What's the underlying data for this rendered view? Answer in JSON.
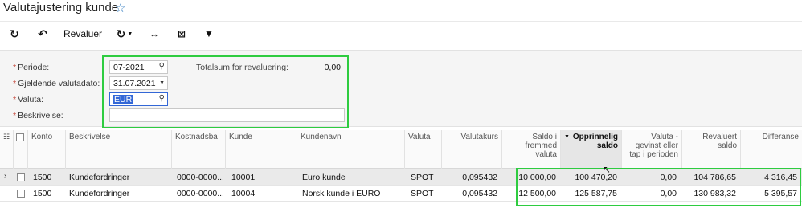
{
  "page": {
    "title": "Valutajustering kunde"
  },
  "toolbar": {
    "revaluer_label": "Revaluer"
  },
  "form": {
    "periode_label": "Periode:",
    "periode_value": "07-2021",
    "dato_label": "Gjeldende valutadato:",
    "dato_value": "31.07.2021",
    "valuta_label": "Valuta:",
    "valuta_value": "EUR",
    "beskrivelse_label": "Beskrivelse:",
    "beskrivelse_value": "",
    "total_label": "Totalsum for revaluering:",
    "total_value": "0,00"
  },
  "grid": {
    "columns": {
      "konto": "Konto",
      "beskrivelse": "Beskrivelse",
      "kostnadssted": "Kostnadsba",
      "kunde": "Kunde",
      "kundenavn": "Kundenavn",
      "valuta": "Valuta",
      "valutakurs": "Valutakurs",
      "saldo_fremmed": "Saldo i fremmed valuta",
      "opprinnelig_saldo": "Opprinnelig saldo",
      "gevinst_tap": "Valuta - gevinst eller tap i perioden",
      "revaluert_saldo": "Revaluert saldo",
      "differanse": "Differanse"
    },
    "rows": [
      {
        "konto": "1500",
        "beskrivelse": "Kundefordringer",
        "kostnadssted": "0000-0000...",
        "kunde": "10001",
        "kundenavn": "Euro kunde",
        "valuta": "SPOT",
        "valutakurs": "0,095432",
        "saldo_fremmed": "10 000,00",
        "opprinnelig_saldo": "100 470,20",
        "gevinst_tap": "0,00",
        "revaluert_saldo": "104 786,65",
        "differanse": "4 316,45"
      },
      {
        "konto": "1500",
        "beskrivelse": "Kundefordringer",
        "kostnadssted": "0000-0000...",
        "kunde": "10004",
        "kundenavn": "Norsk kunde i EURO",
        "valuta": "SPOT",
        "valutakurs": "0,095432",
        "saldo_fremmed": "12 500,00",
        "opprinnelig_saldo": "125 587,75",
        "gevinst_tap": "0,00",
        "revaluert_saldo": "130 983,32",
        "differanse": "5 395,57"
      }
    ]
  },
  "colors": {
    "highlight": "#2ecc40",
    "accent": "#3b82c4"
  }
}
